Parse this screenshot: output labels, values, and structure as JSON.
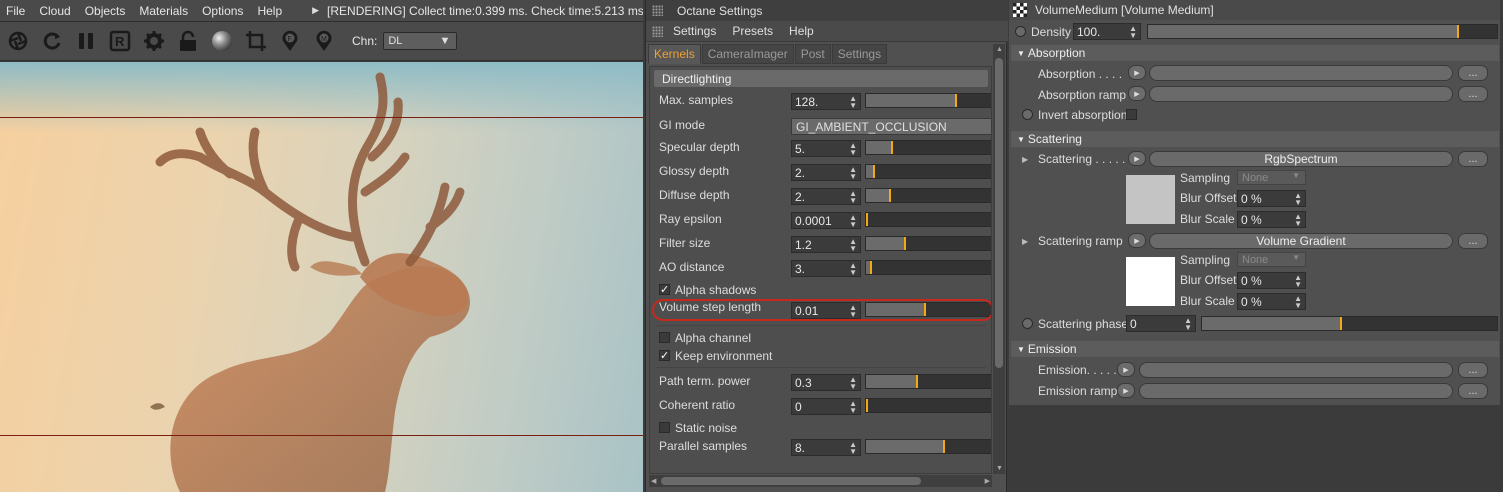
{
  "viewer": {
    "menu": [
      "File",
      "Cloud",
      "Objects",
      "Materials",
      "Options",
      "Help"
    ],
    "status": "[RENDERING] Collect time:0.399 ms.  Check time:5.213 ms.  c",
    "toolbar_icons": [
      "aperture-icon",
      "refresh-icon",
      "pause-icon",
      "region-icon",
      "gear-icon",
      "lock-icon",
      "sphere-icon",
      "crop-icon",
      "pin-f-icon",
      "pin-m-icon"
    ],
    "channel_label": "Chn:",
    "channel_value": "DL"
  },
  "octane": {
    "title": "Octane Settings",
    "menu": [
      "Settings",
      "Presets",
      "Help"
    ],
    "tabs": [
      "Kernels",
      "CameraImager",
      "Post",
      "Settings"
    ],
    "active_tab": "Kernels",
    "group": "Directlighting",
    "fields": {
      "max_samples": {
        "label": "Max. samples",
        "value": "128.",
        "level": 0.72
      },
      "gi_mode": {
        "label": "GI mode",
        "value": "GI_AMBIENT_OCCLUSION"
      },
      "specular_depth": {
        "label": "Specular depth",
        "value": "5.",
        "level": 0.2
      },
      "glossy_depth": {
        "label": "Glossy depth",
        "value": "2.",
        "level": 0.06
      },
      "diffuse_depth": {
        "label": "Diffuse depth",
        "value": "2.",
        "level": 0.19
      },
      "ray_epsilon": {
        "label": "Ray epsilon",
        "value": "0.0001",
        "level": 0.0
      },
      "filter_size": {
        "label": "Filter size",
        "value": "1.2",
        "level": 0.31
      },
      "ao_distance": {
        "label": "AO distance",
        "value": "3.",
        "level": 0.03
      },
      "alpha_shadows": {
        "label": "Alpha shadows",
        "checked": "✓"
      },
      "volume_step_length": {
        "label": "Volume step length",
        "value": "0.01",
        "level": 0.47
      },
      "alpha_channel": {
        "label": "Alpha channel",
        "checked": ""
      },
      "keep_environment": {
        "label": "Keep environment",
        "checked": "✓"
      },
      "path_term_power": {
        "label": "Path term. power",
        "value": "0.3",
        "level": 0.41
      },
      "coherent_ratio": {
        "label": "Coherent ratio",
        "value": "0",
        "level": 0.0
      },
      "static_noise": {
        "label": "Static noise",
        "checked": ""
      },
      "parallel_samples": {
        "label": "Parallel samples",
        "value": "8.",
        "level": 0.63
      }
    }
  },
  "volume": {
    "title": "VolumeMedium [Volume Medium]",
    "density": {
      "label": "Density",
      "value": "100.",
      "level": 0.89
    },
    "absorption_section": "Absorption",
    "absorption": {
      "label": "Absorption . . . .",
      "value": ""
    },
    "absorption_ramp": {
      "label": "Absorption ramp",
      "value": ""
    },
    "invert_absorption": {
      "label": "Invert absorption"
    },
    "scattering_section": "Scattering",
    "scattering": {
      "label": "Scattering . . . . . .",
      "value": "RgbSpectrum",
      "swatch": "#c4c4c4"
    },
    "scattering_sub": {
      "sampling_label": "Sampling",
      "sampling_value": "None",
      "blur_offset_label": "Blur Offset",
      "blur_offset_value": "0 %",
      "blur_scale_label": "Blur Scale",
      "blur_scale_value": "0 %"
    },
    "scattering_ramp": {
      "label": "Scattering ramp",
      "value": "Volume Gradient",
      "swatch": "#ffffff"
    },
    "scattering_ramp_sub": {
      "sampling_label": "Sampling",
      "sampling_value": "None",
      "blur_offset_label": "Blur Offset",
      "blur_offset_value": "0 %",
      "blur_scale_label": "Blur Scale",
      "blur_scale_value": "0 %"
    },
    "scattering_phase": {
      "label": "Scattering phase",
      "value": "0",
      "level": 0.47
    },
    "emission_section": "Emission",
    "emission": {
      "label": "Emission. . . . .",
      "value": ""
    },
    "emission_ramp": {
      "label": "Emission ramp",
      "value": ""
    },
    "dots": "..."
  }
}
